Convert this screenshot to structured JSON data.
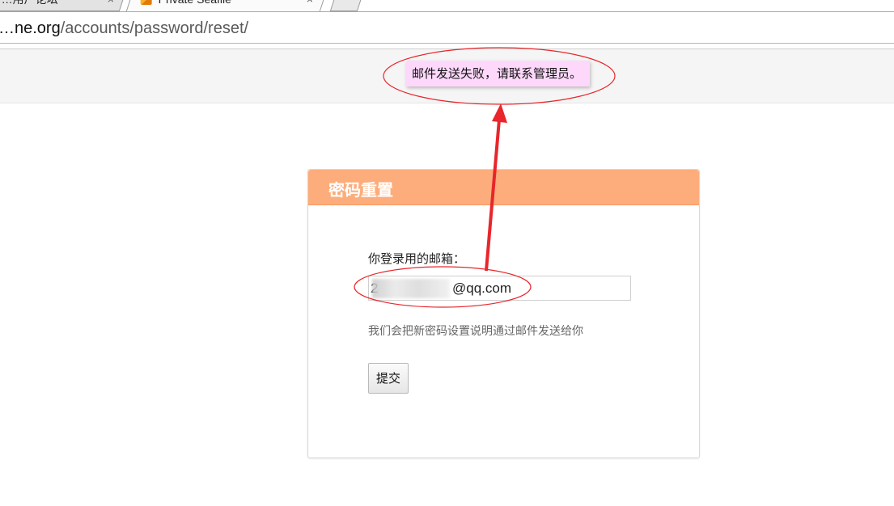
{
  "browser": {
    "tabs": [
      {
        "label": "…用户论坛",
        "close": "×",
        "active": false
      },
      {
        "label": "Private Seafile",
        "close": "×",
        "active": true
      }
    ],
    "url": {
      "host": "…ne.org",
      "path": "/accounts/password/reset/"
    }
  },
  "alert": {
    "message": "邮件发送失败，请联系管理员。"
  },
  "form": {
    "title": "密码重置",
    "email_label": "你登录用的邮箱：",
    "email_prefix": "2",
    "email_suffix": "@qq.com",
    "helper": "我们会把新密码设置说明通过邮件发送给你",
    "submit_label": "提交"
  },
  "colors": {
    "panel_header": "#fdad7b",
    "alert_bg": "#fdd8fb",
    "annotation": "#e8262b"
  }
}
